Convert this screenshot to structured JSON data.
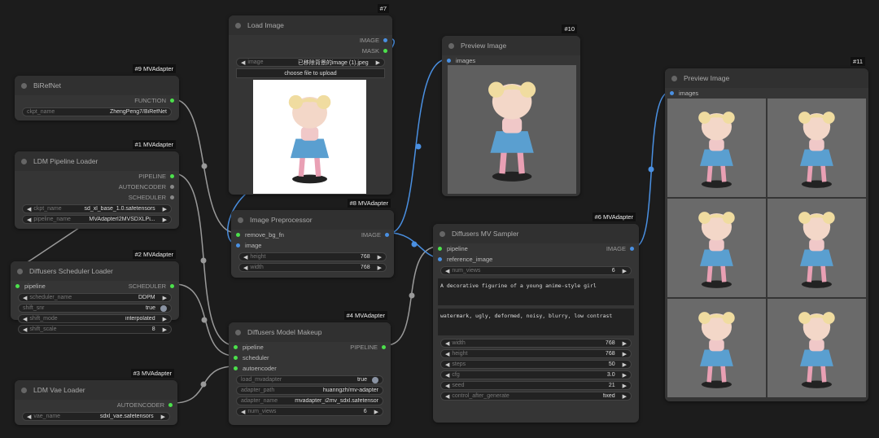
{
  "colors": {
    "green": "#4ce04c",
    "blue": "#4a90e2",
    "gray": "#888888",
    "wire": "#9a9a9a"
  },
  "nodes": {
    "n9": {
      "badge": "#9 MVAdapter",
      "title": "BiRefNet",
      "outputs": [
        {
          "label": "FUNCTION",
          "color": "green"
        }
      ],
      "widgets": [
        {
          "type": "text",
          "label": "ckpt_name",
          "value": "ZhengPeng7/BiRefNet"
        }
      ]
    },
    "n1": {
      "badge": "#1 MVAdapter",
      "title": "LDM Pipeline Loader",
      "outputs": [
        {
          "label": "PIPELINE",
          "color": "green"
        },
        {
          "label": "AUTOENCODER",
          "color": "gray"
        },
        {
          "label": "SCHEDULER",
          "color": "gray"
        }
      ],
      "widgets": [
        {
          "type": "combo",
          "label": "ckpt_name",
          "value": "sd_xl_base_1.0.safetensors"
        },
        {
          "type": "combo",
          "label": "pipeline_name",
          "value": "MVAdapterI2MVSDXLPi..."
        }
      ]
    },
    "n2": {
      "badge": "#2 MVAdapter",
      "title": "Diffusers Scheduler Loader",
      "inputs": [
        {
          "label": "pipeline",
          "color": "green"
        }
      ],
      "outputs": [
        {
          "label": "SCHEDULER",
          "color": "green"
        }
      ],
      "widgets": [
        {
          "type": "combo",
          "label": "scheduler_name",
          "value": "DDPM"
        },
        {
          "type": "toggle",
          "label": "shift_snr",
          "value": "true"
        },
        {
          "type": "combo",
          "label": "shift_mode",
          "value": "interpolated"
        },
        {
          "type": "combo",
          "label": "shift_scale",
          "value": "8"
        }
      ]
    },
    "n3": {
      "badge": "#3 MVAdapter",
      "title": "LDM Vae Loader",
      "outputs": [
        {
          "label": "AUTOENCODER",
          "color": "green"
        }
      ],
      "widgets": [
        {
          "type": "combo",
          "label": "vae_name",
          "value": "sdxl_vae.safetensors"
        }
      ]
    },
    "n7": {
      "badge": "#7",
      "title": "Load Image",
      "outputs": [
        {
          "label": "IMAGE",
          "color": "blue"
        },
        {
          "label": "MASK",
          "color": "green"
        }
      ],
      "widgets": [
        {
          "type": "combo",
          "label": "image",
          "value": "已移除背景的image (1).jpeg"
        },
        {
          "type": "button",
          "label": "choose file to upload"
        }
      ]
    },
    "n8": {
      "badge": "#8 MVAdapter",
      "title": "Image Preprocessor",
      "inputs": [
        {
          "label": "remove_bg_fn",
          "color": "green"
        },
        {
          "label": "image",
          "color": "blue"
        }
      ],
      "outputs": [
        {
          "label": "IMAGE",
          "color": "blue"
        }
      ],
      "widgets": [
        {
          "type": "combo",
          "label": "height",
          "value": "768"
        },
        {
          "type": "combo",
          "label": "width",
          "value": "768"
        }
      ]
    },
    "n4": {
      "badge": "#4 MVAdapter",
      "title": "Diffusers Model Makeup",
      "inputs": [
        {
          "label": "pipeline",
          "color": "green"
        },
        {
          "label": "scheduler",
          "color": "green"
        },
        {
          "label": "autoencoder",
          "color": "green"
        }
      ],
      "outputs": [
        {
          "label": "PIPELINE",
          "color": "green"
        }
      ],
      "widgets": [
        {
          "type": "toggle",
          "label": "load_mvadapter",
          "value": "true"
        },
        {
          "type": "text",
          "label": "adapter_path",
          "value": "huanngzh/mv-adapter"
        },
        {
          "type": "text",
          "label": "adapter_name",
          "value": "mvadapter_i2mv_sdxl.safetensor"
        },
        {
          "type": "combo",
          "label": "num_views",
          "value": "6"
        }
      ]
    },
    "n10": {
      "badge": "#10",
      "title": "Preview Image",
      "inputs": [
        {
          "label": "images",
          "color": "blue"
        }
      ]
    },
    "n6": {
      "badge": "#6 MVAdapter",
      "title": "Diffusers MV Sampler",
      "inputs": [
        {
          "label": "pipeline",
          "color": "green"
        },
        {
          "label": "reference_image",
          "color": "blue"
        }
      ],
      "outputs": [
        {
          "label": "IMAGE",
          "color": "blue"
        }
      ],
      "widgets": [
        {
          "type": "combo",
          "label": "num_views",
          "value": "6"
        },
        {
          "type": "textarea",
          "value": "A decorative figurine of a young anime-style girl"
        },
        {
          "type": "textarea",
          "value": "watermark, ugly, deformed, noisy, blurry, low contrast"
        },
        {
          "type": "combo",
          "label": "width",
          "value": "768"
        },
        {
          "type": "combo",
          "label": "height",
          "value": "768"
        },
        {
          "type": "combo",
          "label": "steps",
          "value": "50"
        },
        {
          "type": "combo",
          "label": "cfg",
          "value": "3.0"
        },
        {
          "type": "combo",
          "label": "seed",
          "value": "21"
        },
        {
          "type": "combo",
          "label": "control_after_generate",
          "value": "fixed"
        }
      ]
    },
    "n11": {
      "badge": "#11",
      "title": "Preview Image",
      "inputs": [
        {
          "label": "images",
          "color": "blue"
        }
      ]
    }
  }
}
